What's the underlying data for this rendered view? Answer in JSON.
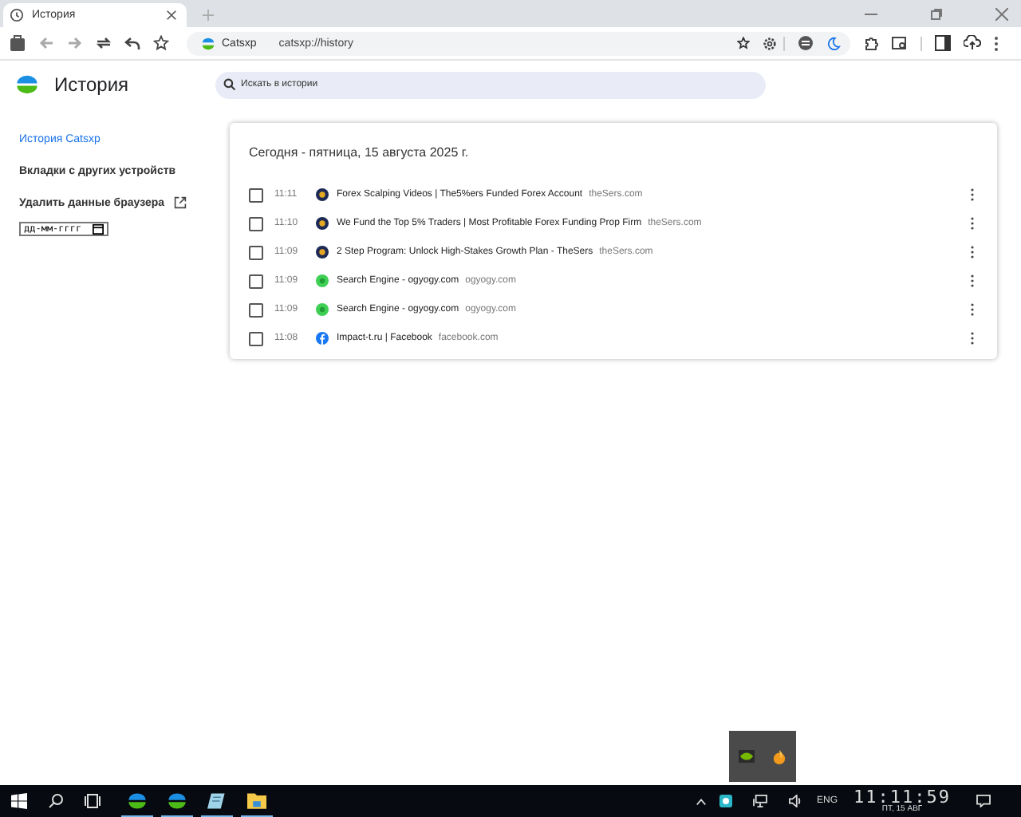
{
  "tab": {
    "title": "История"
  },
  "address_bar": {
    "site_label": "Catsxp",
    "url": "catsxp://history"
  },
  "page": {
    "title": "История",
    "search": {
      "placeholder": "Искать в истории"
    }
  },
  "sidebar": {
    "items": [
      {
        "label": "История Catsxp",
        "selected": true
      },
      {
        "label": "Вкладки с других устройств",
        "selected": false
      },
      {
        "label": "Удалить данные браузера",
        "selected": false,
        "kind": "external"
      }
    ],
    "date_field": {
      "placeholder": "дд-мм-гггг"
    }
  },
  "history": {
    "heading": "Сегодня - пятница, 15 августа 2025 г.",
    "entries": [
      {
        "checked": false,
        "time": "11:11",
        "kind": "thesers",
        "title": "Forex Scalping Videos | The5%ers Funded Forex Account",
        "domain": "theSers.com"
      },
      {
        "checked": false,
        "time": "11:10",
        "kind": "thesers",
        "title": "We Fund the Top 5% Traders | Most Profitable Forex Funding Prop Firm",
        "domain": "theSers.com"
      },
      {
        "checked": false,
        "time": "11:09",
        "kind": "thesers",
        "title": "2 Step Program: Unlock High-Stakes Growth Plan - TheSers",
        "domain": "theSers.com"
      },
      {
        "checked": false,
        "time": "11:09",
        "kind": "ogyogy",
        "title": "Search Engine - ogyogy.com",
        "domain": "ogyogy.com"
      },
      {
        "checked": false,
        "time": "11:09",
        "kind": "ogyogy",
        "title": "Search Engine - ogyogy.com",
        "domain": "ogyogy.com"
      },
      {
        "checked": false,
        "time": "11:08",
        "kind": "facebook",
        "title": "Impact-t.ru | Facebook",
        "domain": "facebook.com"
      }
    ]
  },
  "taskbar": {
    "language": "ENG",
    "time": "11:11:59",
    "date": "ПТ, 15 АВГ"
  }
}
